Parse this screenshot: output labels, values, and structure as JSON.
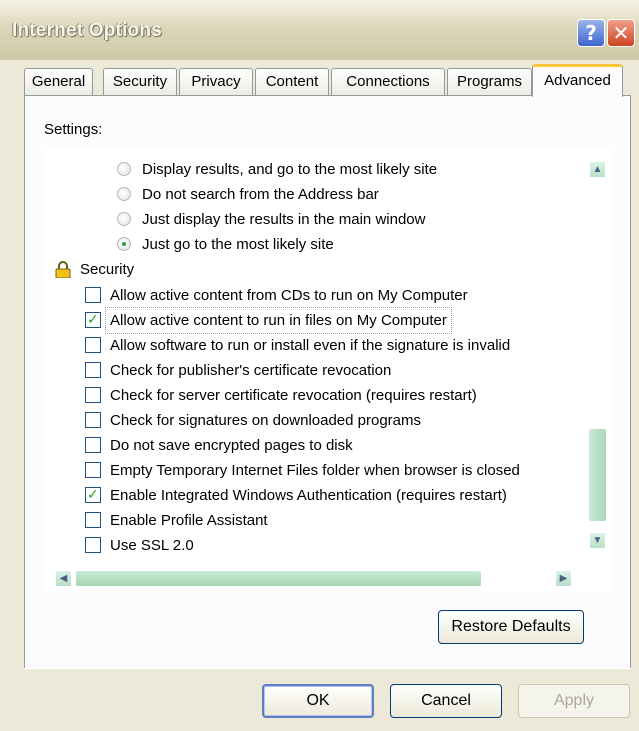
{
  "window": {
    "title": "Internet Options",
    "help_label": "?",
    "close_label": "✕"
  },
  "tabs": [
    "General",
    "Security",
    "Privacy",
    "Content",
    "Connections",
    "Programs",
    "Advanced"
  ],
  "settings_label": "Settings:",
  "options": [
    {
      "kind": "radio",
      "label": "Display results, and go to the most likely site",
      "checked": false
    },
    {
      "kind": "radio",
      "label": "Do not search from the Address bar",
      "checked": false
    },
    {
      "kind": "radio",
      "label": "Just display the results in the main window",
      "checked": false
    },
    {
      "kind": "radio",
      "label": "Just go to the most likely site",
      "checked": true
    },
    {
      "kind": "group",
      "label": "Security",
      "icon": "lock-icon"
    },
    {
      "kind": "check",
      "label": "Allow active content from CDs to run on My Computer",
      "checked": false
    },
    {
      "kind": "check",
      "label": "Allow active content to run in files on My Computer",
      "checked": true,
      "focused": true
    },
    {
      "kind": "check",
      "label": "Allow software to run or install even if the signature is invalid",
      "checked": false
    },
    {
      "kind": "check",
      "label": "Check for publisher's certificate revocation",
      "checked": false
    },
    {
      "kind": "check",
      "label": "Check for server certificate revocation (requires restart)",
      "checked": false
    },
    {
      "kind": "check",
      "label": "Check for signatures on downloaded programs",
      "checked": false
    },
    {
      "kind": "check",
      "label": "Do not save encrypted pages to disk",
      "checked": false
    },
    {
      "kind": "check",
      "label": "Empty Temporary Internet Files folder when browser is closed",
      "checked": false
    },
    {
      "kind": "check",
      "label": "Enable Integrated Windows Authentication (requires restart)",
      "checked": true
    },
    {
      "kind": "check",
      "label": "Enable Profile Assistant",
      "checked": false
    },
    {
      "kind": "check",
      "label": "Use SSL 2.0",
      "checked": false
    }
  ],
  "buttons": {
    "restore_defaults": "Restore Defaults",
    "ok": "OK",
    "cancel": "Cancel",
    "apply": "Apply"
  },
  "colors": {
    "face": "#ece9d8",
    "accent_tab": "#ffc83c",
    "check": "#21a121"
  }
}
